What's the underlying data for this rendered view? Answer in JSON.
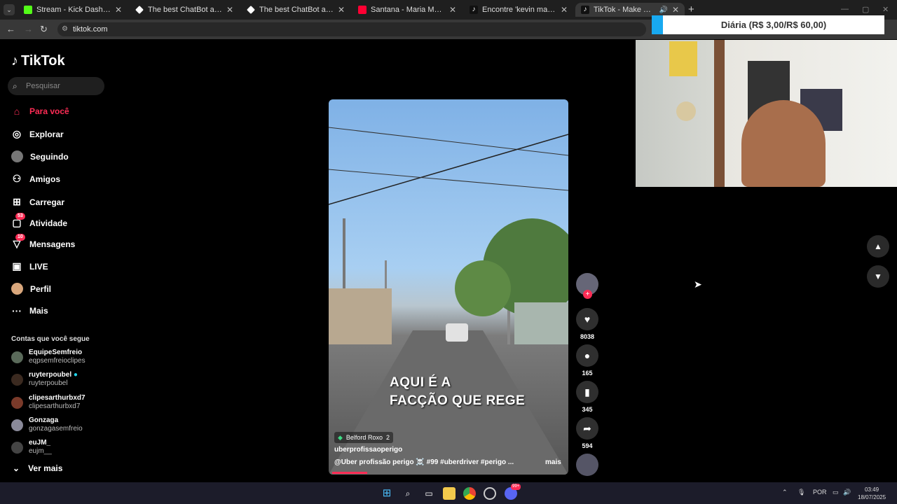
{
  "browser": {
    "tabs": [
      {
        "title": "Stream - Kick Dashboard",
        "favicon": "kick-icon",
        "color": "#53fc18",
        "active": false
      },
      {
        "title": "The best ChatBot and Widgets",
        "favicon": "diamond-icon",
        "color": "#ffffff",
        "active": false
      },
      {
        "title": "The best ChatBot and Widgets",
        "favicon": "diamond-icon",
        "color": "#ffffff",
        "active": false
      },
      {
        "title": "Santana - Maria Maria (Official",
        "favicon": "youtube-icon",
        "color": "#ff0033",
        "active": false
      },
      {
        "title": "Encontre 'kevin machuca' no Tik",
        "favicon": "tiktok-icon",
        "color": "#ffffff",
        "active": false
      },
      {
        "title": "TikTok - Make Your Day",
        "favicon": "tiktok-icon",
        "color": "#ffffff",
        "active": true
      }
    ],
    "url": "tiktok.com"
  },
  "overlay": {
    "text": "Diária (R$ 3,00/R$ 60,00)",
    "accent": "#18a9f0"
  },
  "tiktok": {
    "logo": "TikTok",
    "search_placeholder": "Pesquisar",
    "nav": [
      {
        "label": "Para você",
        "icon": "home-icon",
        "selected": true
      },
      {
        "label": "Explorar",
        "icon": "compass-icon"
      },
      {
        "label": "Seguindo",
        "icon": "following-icon"
      },
      {
        "label": "Amigos",
        "icon": "friends-icon"
      },
      {
        "label": "Carregar",
        "icon": "upload-icon"
      },
      {
        "label": "Atividade",
        "icon": "activity-icon",
        "badge": "53"
      },
      {
        "label": "Mensagens",
        "icon": "messages-icon",
        "badge": "10"
      },
      {
        "label": "LIVE",
        "icon": "live-icon"
      },
      {
        "label": "Perfil",
        "icon": "profile-icon"
      },
      {
        "label": "Mais",
        "icon": "more-icon"
      }
    ],
    "following_header": "Contas que você segue",
    "following": [
      {
        "name": "EquipeSemfreio",
        "handle": "eqpsemfreioclipes"
      },
      {
        "name": "ruyterpoubel",
        "handle": "ruyterpoubel",
        "verified": true
      },
      {
        "name": "clipesarthurbxd7",
        "handle": "clipesarthurbxd7"
      },
      {
        "name": "Gonzaga",
        "handle": "gonzagasemfreio"
      },
      {
        "name": "euJM_",
        "handle": "eujm__"
      }
    ],
    "see_more": "Ver mais",
    "video": {
      "caption_line1": "AQUI É A",
      "caption_line2": "FACÇÃO QUE REGE",
      "location": "Belford Roxo",
      "location_count": "2",
      "username": "uberprofissaoperigo",
      "description": "@Uber profissão perigo ☠️ #99 #uberdriver #perigo ...",
      "more": "mais",
      "progress": 0.15
    },
    "actions": {
      "likes": "8038",
      "comments": "165",
      "saves": "345",
      "shares": "594"
    },
    "accent": "#fe2c55"
  },
  "taskbar": {
    "language": "POR",
    "time": "03:49",
    "date": "18/07/2025",
    "discord_badge": "99+"
  }
}
